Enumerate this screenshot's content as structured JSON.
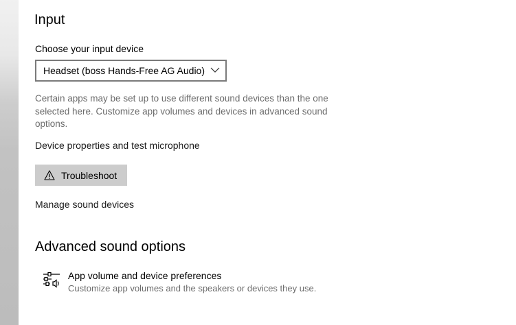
{
  "input": {
    "title": "Input",
    "device_label": "Choose your input device",
    "selected_device": "Headset (boss Hands-Free AG Audio)",
    "description": "Certain apps may be set up to use different sound devices than the one selected here. Customize app volumes and devices in advanced sound options.",
    "device_properties_link": "Device properties and test microphone",
    "troubleshoot_label": "Troubleshoot",
    "manage_link": "Manage sound devices"
  },
  "advanced": {
    "title": "Advanced sound options",
    "item_title": "App volume and device preferences",
    "item_subtitle": "Customize app volumes and the speakers or devices they use."
  },
  "icons": {
    "dropdown": "chevron-down-icon",
    "troubleshoot": "warning-icon",
    "app_volume": "mixer-sliders-icon"
  },
  "colors": {
    "button_bg": "#cccccc",
    "secondary_text": "#6b6b6b",
    "dropdown_border": "#7a7a7a"
  }
}
